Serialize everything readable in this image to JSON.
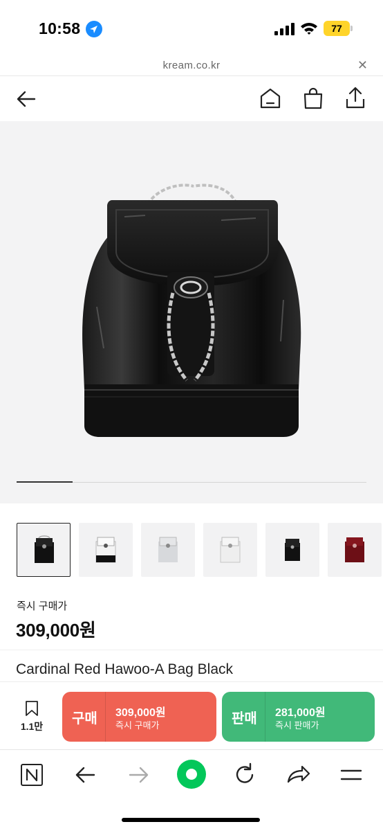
{
  "status_bar": {
    "time": "10:58",
    "battery": "77",
    "location_icon": "location-arrow-icon",
    "signal_icon": "cellular-signal-icon",
    "wifi_icon": "wifi-icon"
  },
  "browser": {
    "url": "kream.co.kr",
    "close_icon": "close-icon"
  },
  "header": {
    "icons": [
      "back-arrow-icon",
      "home-icon",
      "shopping-bag-icon",
      "share-icon"
    ]
  },
  "gallery": {
    "image": "black-patent-leather-backpack-with-chain-strap",
    "progress": 0.16,
    "thumbnails": [
      {
        "variant": "black",
        "active": true
      },
      {
        "variant": "white-black",
        "active": false
      },
      {
        "variant": "silver",
        "active": false
      },
      {
        "variant": "white-silver",
        "active": false
      },
      {
        "variant": "black-small",
        "active": false
      },
      {
        "variant": "red",
        "active": false
      }
    ]
  },
  "product": {
    "price_label": "즉시 구매가",
    "price": "309,000원",
    "name": "Cardinal Red Hawoo-A Bag Black"
  },
  "actions": {
    "wish_count": "1.1만",
    "buy": {
      "label": "구매",
      "price": "309,000원",
      "sub": "즉시 구매가",
      "color": "#ef6253"
    },
    "sell": {
      "label": "판매",
      "price": "281,000원",
      "sub": "즉시 판매가",
      "color": "#41b979"
    }
  },
  "toolbar": {
    "icons": [
      "naver-n-icon",
      "back-icon",
      "forward-icon",
      "green-dot-icon",
      "reload-icon",
      "share-arrow-icon",
      "menu-icon"
    ],
    "accent": "#03c75a"
  }
}
